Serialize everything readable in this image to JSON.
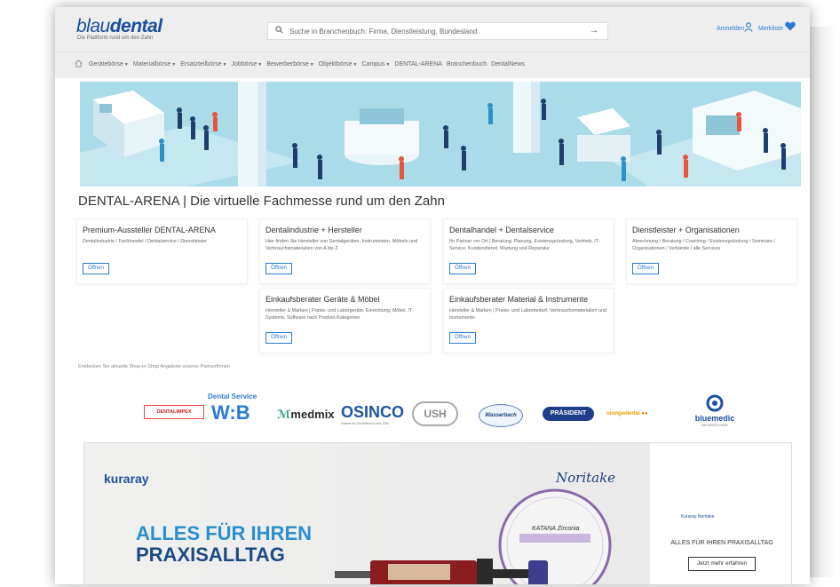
{
  "header": {
    "logo_part1": "blau",
    "logo_part2": "dental",
    "logo_sub": "Die Plattform rund um den Zahn",
    "search_placeholder": "Suche in Branchenbuch: Firma, Dienstleistung, Bundesland",
    "login_label": "Anmelden",
    "wishlist_label": "Merkliste"
  },
  "nav": {
    "items": [
      {
        "label": "Gerätebörse",
        "dropdown": true
      },
      {
        "label": "Materialbörse",
        "dropdown": true
      },
      {
        "label": "Ersatzteilbörse",
        "dropdown": true
      },
      {
        "label": "Jobbörse",
        "dropdown": true
      },
      {
        "label": "Bewerberbörse",
        "dropdown": true
      },
      {
        "label": "Objektbörse",
        "dropdown": true
      },
      {
        "label": "Campus",
        "dropdown": true
      },
      {
        "label": "DENTAL-ARENA",
        "dropdown": false
      },
      {
        "label": "Branchenbuch",
        "dropdown": false
      },
      {
        "label": "DentalNews",
        "dropdown": false
      }
    ]
  },
  "main": {
    "title": "DENTAL-ARENA | Die virtuelle Fachmesse rund um den Zahn",
    "cards": [
      {
        "title": "Premium-Aussteller DENTAL-ARENA",
        "desc": "Dentalindustrie / Fachhandel / Dentalservice / Dienstleister",
        "button": "Öffnen"
      },
      {
        "title": "Dentalindustrie + Hersteller",
        "desc": "Hier finden Sie Hersteller von Dentalgeräten, Instrumenten, Möbeln und Verbrauchsmaterialien von A bis Z",
        "button": "Öffnen"
      },
      {
        "title": "Dentalhandel + Dentalservice",
        "desc": "Ihr Partner vor Ort | Beratung, Planung, Existenzgründung, Vertrieb, IT-Service, Kundendienst, Wartung und Reparatur",
        "button": "Öffnen"
      },
      {
        "title": "Dienstleister + Organisationen",
        "desc": "Abrechnung / Beratung / Coaching / Existenzgründung / Seminare / Organisationen / Verbände / alle Services",
        "button": "Öffnen"
      },
      {
        "title": "Einkaufsberater Geräte & Möbel",
        "desc": "Hersteller & Marken | Praxis- und Laborgeräte, Einrichtung, Möbel, IT-Systeme, Software nach Produkt-Kategorien",
        "button": "Öffnen"
      },
      {
        "title": "Einkaufsberater Material & Instrumente",
        "desc": "Hersteller & Marken | Praxis- und Laborbedarf, Verbrauchsmaterialien und Instrumente.",
        "button": "Öffnen"
      }
    ],
    "partner_note": "Entdecken Sie aktuelle Shop-in-Shop Angebote unserer Partnerfirmen",
    "logos": {
      "dentalimpex": "DENTALIMPEX",
      "ws_top": "Dental Service",
      "ws_bottom": "W:B",
      "medmix": "medmix",
      "osinco": "OSINCO",
      "osinco_sub": "Partner für Dentaltechnik seit 1984",
      "ush": "USH",
      "wasserbach": "Wasserbach",
      "prasident": "PRÄSIDENT",
      "orangedental": "orangedental",
      "bluemedic": "bluemedic",
      "bluemedic_sub": "MEDIZINTECHNIK"
    }
  },
  "ad": {
    "brand_left": "kuraray",
    "brand_right": "Noritake",
    "headline1": "ALLES FÜR IHREN",
    "headline2": "PRAXISALLTAG",
    "right_brand": "Kuraray Noritake",
    "right_text": "ALLES FÜR IHREN PRAXISALLTAG",
    "right_button": "Jetzt mehr erfahren",
    "product_label": "KATANA Zirconia"
  },
  "colors": {
    "accent": "#2a7bd6",
    "logo": "#1a4f9c",
    "hero_bg": "#a9dbe8",
    "header_bg": "#eeeeee"
  }
}
